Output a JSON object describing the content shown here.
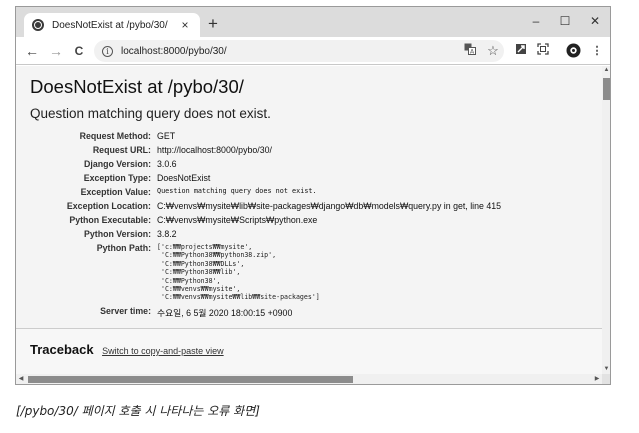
{
  "browser": {
    "tab_title": "DoesNotExist at /pybo/30/",
    "tab_close": "×",
    "new_tab": "+",
    "window_controls": {
      "minimize": "–",
      "maximize": "☐",
      "close": "✕"
    },
    "nav": {
      "back": "←",
      "forward": "→",
      "reload": "C"
    },
    "url": "localhost:8000/pybo/30/",
    "icons": [
      "globe-icon",
      "info-icon",
      "translate-icon",
      "star-icon",
      "extension-icon",
      "screenshot-icon",
      "profile-icon",
      "menu-icon"
    ]
  },
  "page": {
    "title": "DoesNotExist at /pybo/30/",
    "message": "Question matching query does not exist.",
    "meta": [
      {
        "label": "Request Method:",
        "value": "GET"
      },
      {
        "label": "Request URL:",
        "value": "http://localhost:8000/pybo/30/"
      },
      {
        "label": "Django Version:",
        "value": "3.0.6"
      },
      {
        "label": "Exception Type:",
        "value": "DoesNotExist"
      },
      {
        "label": "Exception Value:",
        "value": "Question matching query does not exist."
      },
      {
        "label": "Exception Location:",
        "value": "C:₩venvs₩mysite₩lib₩site-packages₩django₩db₩models₩query.py in get, line 415"
      },
      {
        "label": "Python Executable:",
        "value": "C:₩venvs₩mysite₩Scripts₩python.exe"
      },
      {
        "label": "Python Version:",
        "value": "3.8.2"
      },
      {
        "label": "Python Path:",
        "value": ""
      },
      {
        "label": "Server time:",
        "value": "수요일, 6 5월 2020 18:00:15 +0900"
      }
    ],
    "python_path": [
      "['c:₩₩projects₩₩mysite',",
      " 'C:₩₩Python38₩₩python38.zip',",
      " 'C:₩₩Python38₩₩DLLs',",
      " 'C:₩₩Python38₩₩lib',",
      " 'C:₩₩Python38',",
      " 'C:₩₩venvs₩₩mysite',",
      " 'C:₩₩venvs₩₩mysite₩₩lib₩₩site-packages']"
    ],
    "traceback_heading": "Traceback",
    "traceback_link": "Switch to copy-and-paste view"
  },
  "caption": "[/pybo/30/ 페이지 호출 시 나타나는 오류 화면]"
}
